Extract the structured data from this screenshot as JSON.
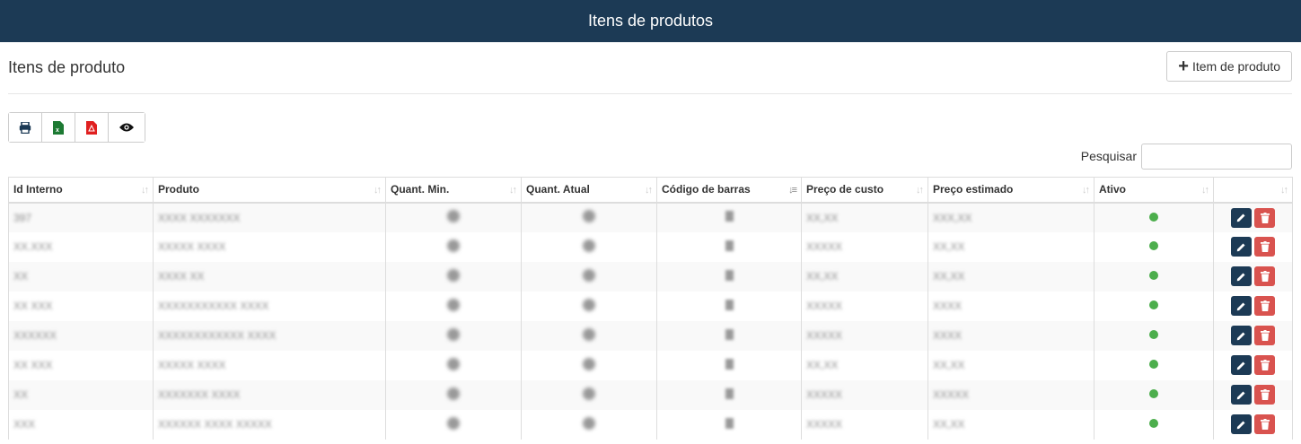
{
  "topbar": {
    "title": "Itens de produtos"
  },
  "page": {
    "title": "Itens de produto",
    "add_button_label": "Item de produto"
  },
  "toolbar": {
    "buttons": [
      "print-icon",
      "excel-icon",
      "pdf-icon",
      "eye-icon"
    ]
  },
  "search": {
    "label": "Pesquisar",
    "value": ""
  },
  "table": {
    "columns": [
      "Id Interno",
      "Produto",
      "Quant. Min.",
      "Quant. Atual",
      "Código de barras",
      "Preço de custo",
      "Preço estimado",
      "Ativo",
      ""
    ],
    "rows": [
      [
        "397",
        "XXXX XXXXXXX",
        "",
        "",
        "",
        "XX,XX",
        "XXX,XX",
        "",
        ""
      ],
      [
        "XX.XXX",
        "XXXXX XXXX",
        "",
        "",
        "",
        "XXXXX",
        "XX,XX",
        "",
        ""
      ],
      [
        "XX",
        "XXXX XX",
        "",
        "",
        "",
        "XX,XX",
        "XX,XX",
        "",
        ""
      ],
      [
        "XX XXX",
        "XXXXXXXXXXX XXXX",
        "",
        "",
        "",
        "XXXXX",
        "XXXX",
        "",
        ""
      ],
      [
        "XXXXXX",
        "XXXXXXXXXXXX XXXX",
        "",
        "",
        "",
        "XXXXX",
        "XXXX",
        "",
        ""
      ],
      [
        "XX XXX",
        "XXXXX XXXX",
        "",
        "",
        "",
        "XX,XX",
        "XX,XX",
        "",
        ""
      ],
      [
        "XX",
        "XXXXXXX XXXX",
        "",
        "",
        "",
        "XXXXX",
        "XXXXX",
        "",
        ""
      ],
      [
        "XXX",
        "XXXXXX XXXX XXXXX",
        "",
        "",
        "",
        "XXXXX",
        "XX,XX",
        "",
        ""
      ]
    ]
  },
  "colors": {
    "topbar": "#1c3a55",
    "edit": "#1c3a55",
    "delete": "#d9534f",
    "active_dot": "#4cae4c"
  }
}
